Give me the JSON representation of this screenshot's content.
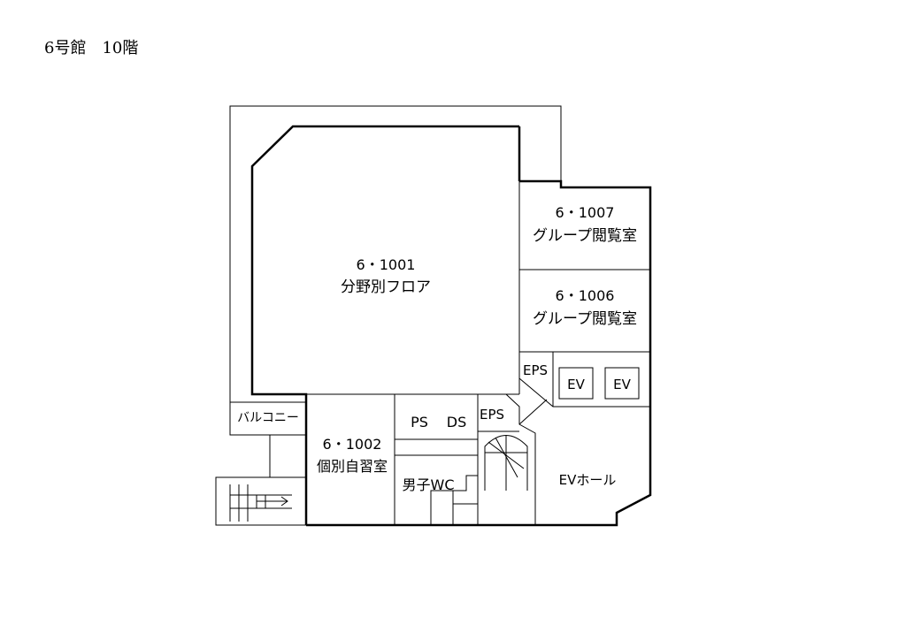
{
  "header": {
    "title": "6号館　10階"
  },
  "rooms": {
    "r1001": {
      "number": "6・1001",
      "name": "分野別フロア"
    },
    "r1007": {
      "number": "6・1007",
      "name": "グループ閲覧室"
    },
    "r1006": {
      "number": "6・1006",
      "name": "グループ閲覧室"
    },
    "r1002": {
      "number": "6・1002",
      "name": "個別自習室"
    }
  },
  "labels": {
    "eps_right": "EPS",
    "ev_left": "EV",
    "ev_right": "EV",
    "eps_stair": "EPS",
    "ps": "PS",
    "ds": "DS",
    "balcony": "バルコニー",
    "wc_men": "男子WC",
    "ev_hall": "EVホール"
  }
}
